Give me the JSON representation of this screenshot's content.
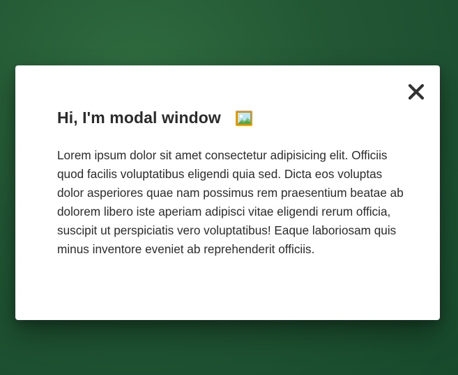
{
  "modal": {
    "title": "Hi, I'm modal window",
    "title_icon": "framed-picture-icon",
    "close_icon": "close-icon",
    "body": "Lorem ipsum dolor sit amet consectetur adipisicing elit. Officiis quod facilis voluptatibus eligendi quia sed. Dicta eos voluptas dolor asperiores quae nam possimus rem praesentium beatae ab dolorem libero iste aperiam adipisci vitae eligendi rerum officia, suscipit ut perspiciatis vero voluptatibus! Eaque laboriosam quis minus inventore eveniet ab reprehenderit officiis."
  },
  "colors": {
    "backdrop": "#225634",
    "modal_background": "#ffffff",
    "text": "#2b2b2b"
  }
}
